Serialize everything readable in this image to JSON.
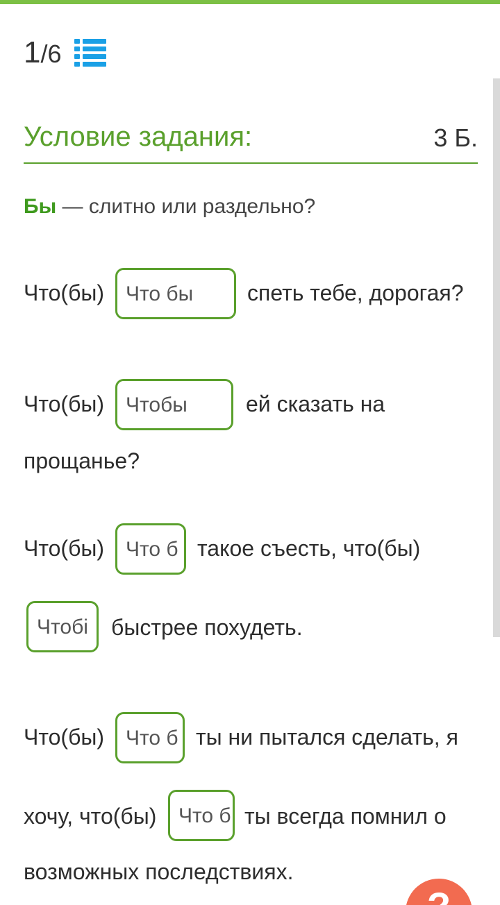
{
  "progress": {
    "current": "1",
    "separator": "/",
    "total": "6",
    "list_icon": "list-icon"
  },
  "header": {
    "title": "Условие задания:",
    "score": "3 Б."
  },
  "question": {
    "bold": "Бы",
    "rest": " — слитно или раздельно?"
  },
  "lines": {
    "l1a": "Что(бы)",
    "l1b": "спеть тебе, дорогая?",
    "l2a": "Что(бы)",
    "l2b": "ей сказать на",
    "l2c": "прощанье?",
    "l3a": "Что(бы)",
    "l3b": "такое съесть, что(бы)",
    "l3c": "быстрее похудеть.",
    "l4a": "Что(бы)",
    "l4b": "ты ни пытался сделать, я",
    "l4c": "хочу, что(бы)",
    "l4d": "ты всегда помнил о",
    "l4e": "возможных последствиях."
  },
  "answers": {
    "a1": "Что бы",
    "a2": "Чтобы",
    "a3": "Что б",
    "a4": "Чтобі",
    "a5": "Что б",
    "a6": "Что б"
  },
  "colors": {
    "accent": "#5aa02c",
    "top_bar": "#7cc045",
    "icon_blue": "#1aa0e6",
    "help_badge": "#f26b50"
  },
  "help_badge": {
    "label": "?",
    "icon": "help-icon"
  }
}
